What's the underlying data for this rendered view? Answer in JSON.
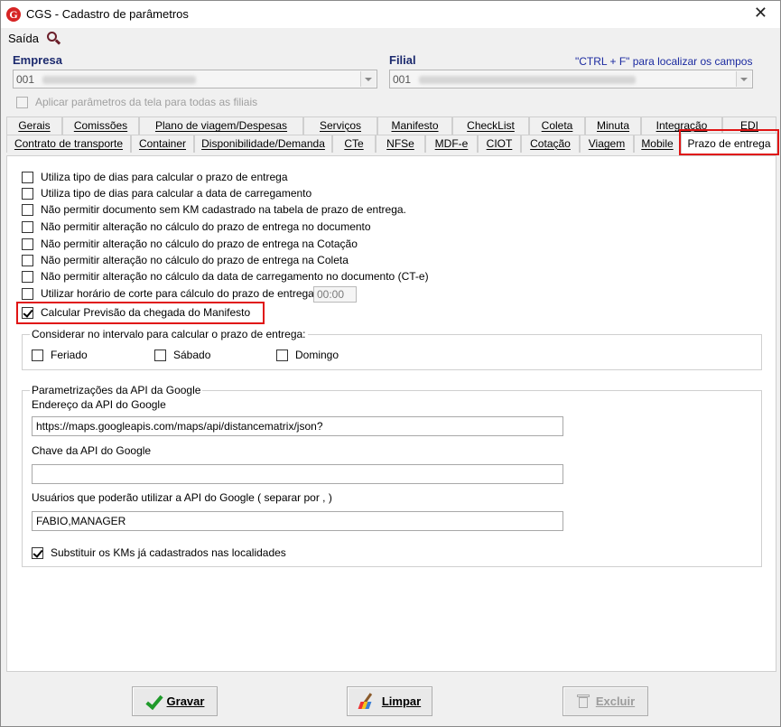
{
  "window": {
    "title": "CGS - Cadastro de parâmetros",
    "close_label": "✕"
  },
  "menu": {
    "saida": "Saída"
  },
  "empresa": {
    "label": "Empresa",
    "value": "001"
  },
  "filial": {
    "label": "Filial",
    "value": "001"
  },
  "hint": "\"CTRL + F\" para localizar os campos",
  "apply_all": {
    "label": "Aplicar parâmetros da tela para todas as filiais",
    "checked": false
  },
  "tabs": {
    "row1": [
      "Gerais",
      "Comissões",
      "Plano de viagem/Despesas",
      "Serviços",
      "Manifesto",
      "CheckList",
      "Coleta",
      "Minuta",
      "Integração",
      "EDI"
    ],
    "row2": [
      "Contrato de transporte",
      "Container",
      "Disponibilidade/Demanda",
      "CTe",
      "NFSe",
      "MDF-e",
      "CIOT",
      "Cotação",
      "Viagem",
      "Mobile",
      "Prazo de entrega"
    ],
    "active": "Prazo de entrega"
  },
  "options": [
    {
      "label": "Utiliza tipo de dias para calcular o prazo de entrega",
      "checked": false
    },
    {
      "label": "Utiliza tipo de dias para calcular a data de carregamento",
      "checked": false
    },
    {
      "label": "Não permitir documento sem KM cadastrado na tabela de prazo de entrega.",
      "checked": false
    },
    {
      "label": "Não permitir alteração no cálculo do prazo de entrega no documento",
      "checked": false
    },
    {
      "label": "Não permitir alteração no cálculo do prazo de entrega na Cotação",
      "checked": false
    },
    {
      "label": "Não permitir alteração no cálculo do prazo de entrega na Coleta",
      "checked": false
    },
    {
      "label": "Não permitir alteração no cálculo da data de carregamento no documento (CT-e)",
      "checked": false
    },
    {
      "label": "Utilizar horário de corte para cálculo do prazo de entrega",
      "checked": false
    },
    {
      "label": "Calcular Previsão da chegada do Manifesto",
      "checked": true
    }
  ],
  "cutoff_time": "00:00",
  "interval_group": {
    "title": "Considerar no intervalo para calcular o prazo de entrega:",
    "feriado": "Feriado",
    "sabado": "Sábado",
    "domingo": "Domingo"
  },
  "google_api": {
    "title": "Parametrizações da API da Google",
    "endereco_label": "Endereço da API do Google",
    "endereco_value": "https://maps.googleapis.com/maps/api/distancematrix/json?",
    "chave_label": "Chave da API do Google",
    "chave_value": "",
    "usuarios_label": "Usuários que poderão utilizar a API do Google ( separar por , )",
    "usuarios_value": "FABIO,MANAGER",
    "substituir_label": "Substituir os KMs já cadastrados nas localidades",
    "substituir_checked": true
  },
  "buttons": {
    "gravar": "Gravar",
    "limpar": "Limpar",
    "excluir": "Excluir"
  }
}
